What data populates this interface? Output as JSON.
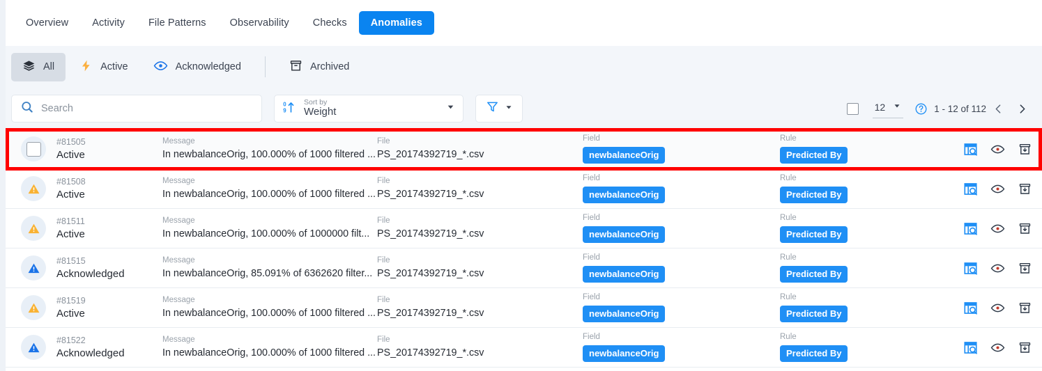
{
  "nav": {
    "tabs": [
      {
        "label": "Overview",
        "active": false
      },
      {
        "label": "Activity",
        "active": false
      },
      {
        "label": "File Patterns",
        "active": false
      },
      {
        "label": "Observability",
        "active": false
      },
      {
        "label": "Checks",
        "active": false
      },
      {
        "label": "Anomalies",
        "active": true
      }
    ]
  },
  "status_filters": [
    {
      "label": "All",
      "icon": "layers-icon",
      "selected": true
    },
    {
      "label": "Active",
      "icon": "lightning-bolt-icon",
      "selected": false
    },
    {
      "label": "Acknowledged",
      "icon": "eye-icon",
      "selected": false
    },
    {
      "label": "Archived",
      "icon": "archive-icon",
      "selected": false
    }
  ],
  "toolbar": {
    "search_placeholder": "Search",
    "search_value": "",
    "sort_caption": "Sort by",
    "sort_value": "Weight",
    "filter_icon": "funnel-icon"
  },
  "pagination": {
    "select_all_checked": false,
    "page_size": "12",
    "range_text": "1 - 12 of 112",
    "help_icon": "help-circle-icon",
    "prev_icon": "chevron-left-icon",
    "next_icon": "chevron-right-icon"
  },
  "columns": {
    "message": "Message",
    "file": "File",
    "field": "Field",
    "rule": "Rule"
  },
  "rows": [
    {
      "id": "#81505",
      "state": "Active",
      "state_icon": "checkbox",
      "message": "In newbalanceOrig, 100.000% of 1000 filtered ...",
      "file": "PS_20174392719_*.csv",
      "field": "newbalanceOrig",
      "rule": "Predicted By",
      "highlighted": true
    },
    {
      "id": "#81508",
      "state": "Active",
      "state_icon": "warning-triangle-orange",
      "message": "In newbalanceOrig, 100.000% of 1000 filtered ...",
      "file": "PS_20174392719_*.csv",
      "field": "newbalanceOrig",
      "rule": "Predicted By",
      "highlighted": false
    },
    {
      "id": "#81511",
      "state": "Active",
      "state_icon": "warning-triangle-orange",
      "message": "In newbalanceOrig, 100.000% of 1000000 filt...",
      "file": "PS_20174392719_*.csv",
      "field": "newbalanceOrig",
      "rule": "Predicted By",
      "highlighted": false
    },
    {
      "id": "#81515",
      "state": "Acknowledged",
      "state_icon": "warning-triangle-blue",
      "message": "In newbalanceOrig, 85.091% of 6362620 filter...",
      "file": "PS_20174392719_*.csv",
      "field": "newbalanceOrig",
      "rule": "Predicted By",
      "highlighted": false
    },
    {
      "id": "#81519",
      "state": "Active",
      "state_icon": "warning-triangle-orange",
      "message": "In newbalanceOrig, 100.000% of 1000 filtered ...",
      "file": "PS_20174392719_*.csv",
      "field": "newbalanceOrig",
      "rule": "Predicted By",
      "highlighted": false
    },
    {
      "id": "#81522",
      "state": "Acknowledged",
      "state_icon": "warning-triangle-blue",
      "message": "In newbalanceOrig, 100.000% of 1000 filtered ...",
      "file": "PS_20174392719_*.csv",
      "field": "newbalanceOrig",
      "rule": "Predicted By",
      "highlighted": false
    }
  ],
  "row_actions": [
    {
      "icon": "data-inspect-icon"
    },
    {
      "icon": "eye-icon"
    },
    {
      "icon": "archive-icon"
    }
  ],
  "colors": {
    "accent_blue": "#0a84f0",
    "pill_blue": "#1f8ff5",
    "warning_orange": "#f9b233",
    "warning_blue": "#1a73e8",
    "highlight_red": "#ff0000",
    "page_bg": "#eef2f7"
  }
}
